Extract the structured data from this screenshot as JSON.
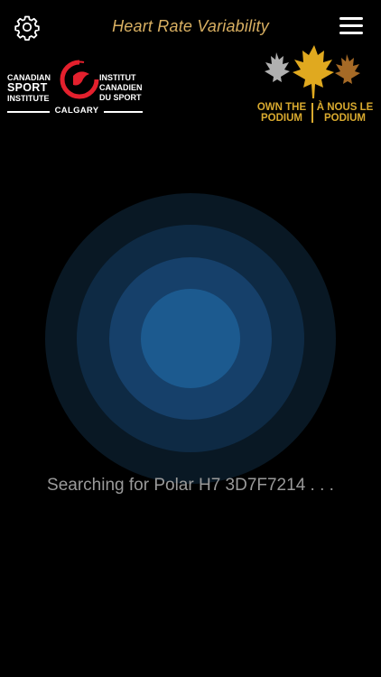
{
  "header": {
    "title": "Heart Rate Variability",
    "settings_icon": "gear-icon",
    "menu_icon": "hamburger-menu-icon"
  },
  "logos": {
    "csi": {
      "left_line1": "CANADIAN",
      "left_line2": "SPORT",
      "left_line3": "INSTITUTE",
      "right_line1": "INSTITUT",
      "right_line2": "CANADIEN",
      "right_line3": "DU SPORT",
      "city": "CALGARY",
      "accent_color": "#e4202d"
    },
    "otp": {
      "left_line1": "OWN THE",
      "left_line2": "PODIUM",
      "right_line1": "À NOUS LE",
      "right_line2": "PODIUM",
      "colors": {
        "silver": "#b0b0b0",
        "gold": "#e0a91f",
        "bronze": "#a66a26"
      }
    }
  },
  "status": {
    "text": "Searching for Polar H7 3D7F7214 . . ."
  },
  "colors": {
    "background": "#000000",
    "title": "#d9b062",
    "status_text": "#9a9a9a"
  }
}
